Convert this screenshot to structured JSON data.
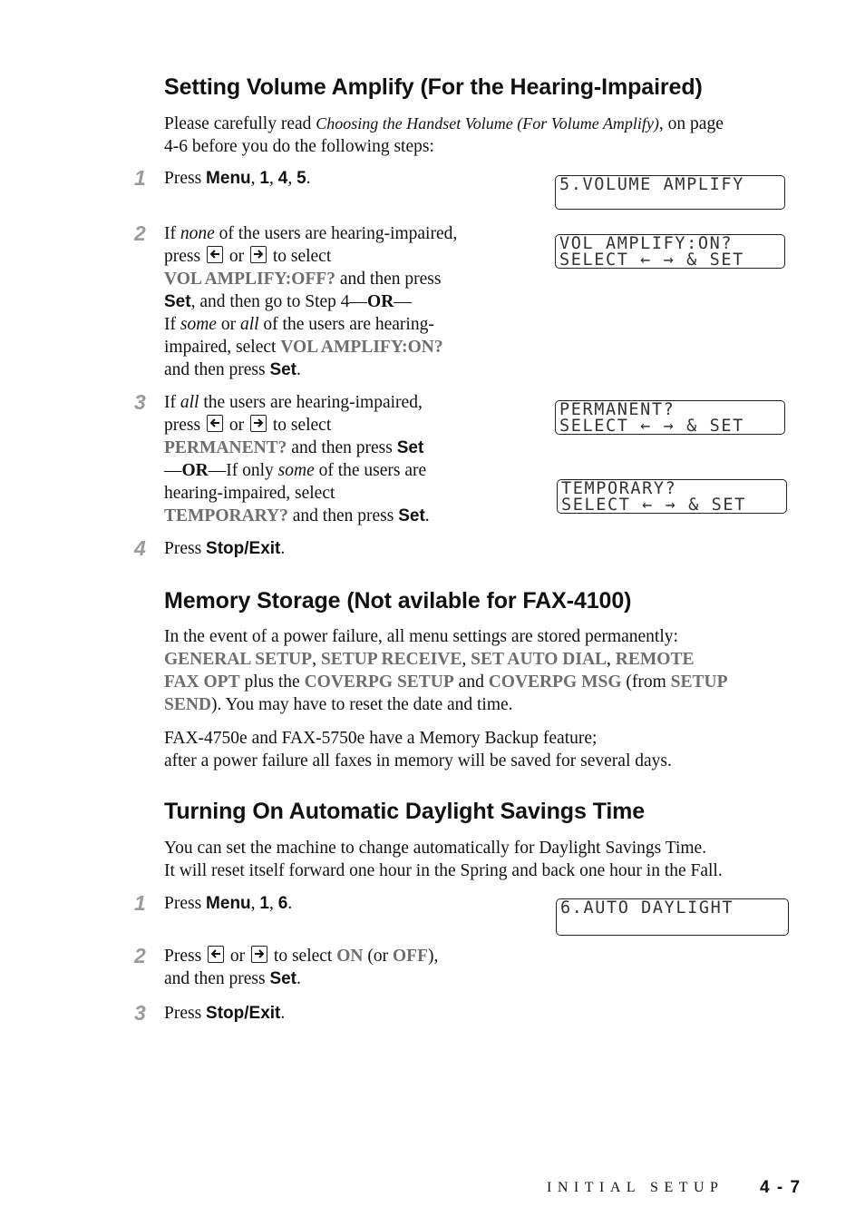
{
  "sections": {
    "volume": {
      "heading": "Setting Volume Amplify (For the Hearing-Impaired)",
      "intro_1": "Please carefully read ",
      "intro_ref": "Choosing the Handset Volume (For Volume Amplify)",
      "intro_2": ", on page",
      "intro_3": "4-6 before you do the following steps:",
      "steps": [
        {
          "num": "1"
        },
        {
          "num": "2"
        },
        {
          "num": "3"
        },
        {
          "num": "4"
        }
      ],
      "lcds": [
        {
          "line1": "5.VOLUME AMPLIFY",
          "line2": ""
        },
        {
          "line1": "VOL AMPLIFY:ON?",
          "line2": "SELECT ← → & SET"
        },
        {
          "line1": "PERMANENT?",
          "line2": "SELECT ← → & SET"
        },
        {
          "line1": "TEMPORARY?",
          "line2": "SELECT ← → & SET"
        }
      ]
    },
    "memory": {
      "heading": "Memory Storage (Not avilable for FAX-4100)",
      "p1_a": "In the event of a power failure, all menu settings are stored permanently:",
      "m1": "GENERAL SETUP",
      "m2": "SETUP RECEIVE",
      "m3": "SET AUTO DIAL",
      "m4": "REMOTE",
      "m4b": "FAX OPT",
      "plus": " plus the ",
      "m5": "COVERPG SETUP",
      "and": " and ",
      "m6": "COVERPG MSG",
      "from": " (from ",
      "m7": "SETUP",
      "m7b": "SEND",
      "tail": "). You may have to reset the date and time.",
      "p2_l1": "FAX-4750e and FAX-5750e have a Memory Backup feature;",
      "p2_l2": "after a power failure all faxes in memory will be saved for several days."
    },
    "daylight": {
      "heading": "Turning On Automatic Daylight Savings Time",
      "p_l1": "You can set the machine to change automatically for Daylight Savings Time.",
      "p_l2": "It will reset itself forward one hour in the Spring and back one hour in the Fall.",
      "steps": [
        {
          "num": "1"
        },
        {
          "num": "2"
        },
        {
          "num": "3"
        }
      ],
      "lcd": {
        "line1": "6.AUTO DAYLIGHT",
        "line2": ""
      },
      "on": "ON",
      "off": "OFF"
    }
  },
  "text": {
    "press": "Press ",
    "menu": "Menu",
    "set": "Set",
    "stop_exit": "Stop/Exit",
    "k1": "1",
    "k4": "4",
    "k5": "5",
    "k6": "6"
  },
  "footer": {
    "chapter": "INITIAL SETUP",
    "page": "4 - 7"
  }
}
